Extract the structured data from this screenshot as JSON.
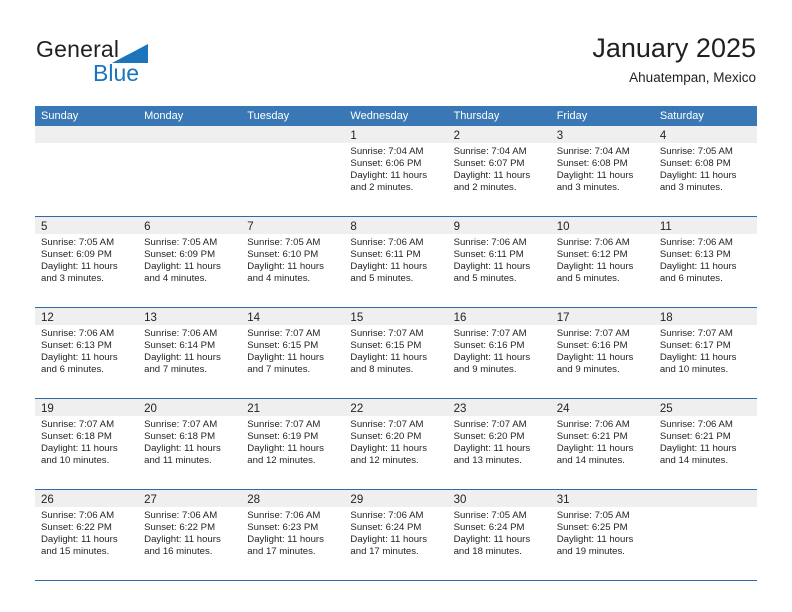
{
  "brand": {
    "name_part1": "General",
    "name_part2": "Blue",
    "accent_color": "#1c75bc"
  },
  "header": {
    "title": "January 2025",
    "subtitle": "Ahuatempan, Mexico"
  },
  "theme": {
    "header_band": "#3a78b5",
    "daynum_band": "#efefef",
    "week_divider": "#2f6aa8"
  },
  "weekdays": [
    "Sunday",
    "Monday",
    "Tuesday",
    "Wednesday",
    "Thursday",
    "Friday",
    "Saturday"
  ],
  "weeks": [
    [
      {
        "day": "",
        "sunrise": "",
        "sunset": "",
        "daylight1": "",
        "daylight2": "",
        "blank": true
      },
      {
        "day": "",
        "sunrise": "",
        "sunset": "",
        "daylight1": "",
        "daylight2": "",
        "blank": true
      },
      {
        "day": "",
        "sunrise": "",
        "sunset": "",
        "daylight1": "",
        "daylight2": "",
        "blank": true
      },
      {
        "day": "1",
        "sunrise": "Sunrise: 7:04 AM",
        "sunset": "Sunset: 6:06 PM",
        "daylight1": "Daylight: 11 hours",
        "daylight2": "and 2 minutes."
      },
      {
        "day": "2",
        "sunrise": "Sunrise: 7:04 AM",
        "sunset": "Sunset: 6:07 PM",
        "daylight1": "Daylight: 11 hours",
        "daylight2": "and 2 minutes."
      },
      {
        "day": "3",
        "sunrise": "Sunrise: 7:04 AM",
        "sunset": "Sunset: 6:08 PM",
        "daylight1": "Daylight: 11 hours",
        "daylight2": "and 3 minutes."
      },
      {
        "day": "4",
        "sunrise": "Sunrise: 7:05 AM",
        "sunset": "Sunset: 6:08 PM",
        "daylight1": "Daylight: 11 hours",
        "daylight2": "and 3 minutes."
      }
    ],
    [
      {
        "day": "5",
        "sunrise": "Sunrise: 7:05 AM",
        "sunset": "Sunset: 6:09 PM",
        "daylight1": "Daylight: 11 hours",
        "daylight2": "and 3 minutes."
      },
      {
        "day": "6",
        "sunrise": "Sunrise: 7:05 AM",
        "sunset": "Sunset: 6:09 PM",
        "daylight1": "Daylight: 11 hours",
        "daylight2": "and 4 minutes."
      },
      {
        "day": "7",
        "sunrise": "Sunrise: 7:05 AM",
        "sunset": "Sunset: 6:10 PM",
        "daylight1": "Daylight: 11 hours",
        "daylight2": "and 4 minutes."
      },
      {
        "day": "8",
        "sunrise": "Sunrise: 7:06 AM",
        "sunset": "Sunset: 6:11 PM",
        "daylight1": "Daylight: 11 hours",
        "daylight2": "and 5 minutes."
      },
      {
        "day": "9",
        "sunrise": "Sunrise: 7:06 AM",
        "sunset": "Sunset: 6:11 PM",
        "daylight1": "Daylight: 11 hours",
        "daylight2": "and 5 minutes."
      },
      {
        "day": "10",
        "sunrise": "Sunrise: 7:06 AM",
        "sunset": "Sunset: 6:12 PM",
        "daylight1": "Daylight: 11 hours",
        "daylight2": "and 5 minutes."
      },
      {
        "day": "11",
        "sunrise": "Sunrise: 7:06 AM",
        "sunset": "Sunset: 6:13 PM",
        "daylight1": "Daylight: 11 hours",
        "daylight2": "and 6 minutes."
      }
    ],
    [
      {
        "day": "12",
        "sunrise": "Sunrise: 7:06 AM",
        "sunset": "Sunset: 6:13 PM",
        "daylight1": "Daylight: 11 hours",
        "daylight2": "and 6 minutes."
      },
      {
        "day": "13",
        "sunrise": "Sunrise: 7:06 AM",
        "sunset": "Sunset: 6:14 PM",
        "daylight1": "Daylight: 11 hours",
        "daylight2": "and 7 minutes."
      },
      {
        "day": "14",
        "sunrise": "Sunrise: 7:07 AM",
        "sunset": "Sunset: 6:15 PM",
        "daylight1": "Daylight: 11 hours",
        "daylight2": "and 7 minutes."
      },
      {
        "day": "15",
        "sunrise": "Sunrise: 7:07 AM",
        "sunset": "Sunset: 6:15 PM",
        "daylight1": "Daylight: 11 hours",
        "daylight2": "and 8 minutes."
      },
      {
        "day": "16",
        "sunrise": "Sunrise: 7:07 AM",
        "sunset": "Sunset: 6:16 PM",
        "daylight1": "Daylight: 11 hours",
        "daylight2": "and 9 minutes."
      },
      {
        "day": "17",
        "sunrise": "Sunrise: 7:07 AM",
        "sunset": "Sunset: 6:16 PM",
        "daylight1": "Daylight: 11 hours",
        "daylight2": "and 9 minutes."
      },
      {
        "day": "18",
        "sunrise": "Sunrise: 7:07 AM",
        "sunset": "Sunset: 6:17 PM",
        "daylight1": "Daylight: 11 hours",
        "daylight2": "and 10 minutes."
      }
    ],
    [
      {
        "day": "19",
        "sunrise": "Sunrise: 7:07 AM",
        "sunset": "Sunset: 6:18 PM",
        "daylight1": "Daylight: 11 hours",
        "daylight2": "and 10 minutes."
      },
      {
        "day": "20",
        "sunrise": "Sunrise: 7:07 AM",
        "sunset": "Sunset: 6:18 PM",
        "daylight1": "Daylight: 11 hours",
        "daylight2": "and 11 minutes."
      },
      {
        "day": "21",
        "sunrise": "Sunrise: 7:07 AM",
        "sunset": "Sunset: 6:19 PM",
        "daylight1": "Daylight: 11 hours",
        "daylight2": "and 12 minutes."
      },
      {
        "day": "22",
        "sunrise": "Sunrise: 7:07 AM",
        "sunset": "Sunset: 6:20 PM",
        "daylight1": "Daylight: 11 hours",
        "daylight2": "and 12 minutes."
      },
      {
        "day": "23",
        "sunrise": "Sunrise: 7:07 AM",
        "sunset": "Sunset: 6:20 PM",
        "daylight1": "Daylight: 11 hours",
        "daylight2": "and 13 minutes."
      },
      {
        "day": "24",
        "sunrise": "Sunrise: 7:06 AM",
        "sunset": "Sunset: 6:21 PM",
        "daylight1": "Daylight: 11 hours",
        "daylight2": "and 14 minutes."
      },
      {
        "day": "25",
        "sunrise": "Sunrise: 7:06 AM",
        "sunset": "Sunset: 6:21 PM",
        "daylight1": "Daylight: 11 hours",
        "daylight2": "and 14 minutes."
      }
    ],
    [
      {
        "day": "26",
        "sunrise": "Sunrise: 7:06 AM",
        "sunset": "Sunset: 6:22 PM",
        "daylight1": "Daylight: 11 hours",
        "daylight2": "and 15 minutes."
      },
      {
        "day": "27",
        "sunrise": "Sunrise: 7:06 AM",
        "sunset": "Sunset: 6:22 PM",
        "daylight1": "Daylight: 11 hours",
        "daylight2": "and 16 minutes."
      },
      {
        "day": "28",
        "sunrise": "Sunrise: 7:06 AM",
        "sunset": "Sunset: 6:23 PM",
        "daylight1": "Daylight: 11 hours",
        "daylight2": "and 17 minutes."
      },
      {
        "day": "29",
        "sunrise": "Sunrise: 7:06 AM",
        "sunset": "Sunset: 6:24 PM",
        "daylight1": "Daylight: 11 hours",
        "daylight2": "and 17 minutes."
      },
      {
        "day": "30",
        "sunrise": "Sunrise: 7:05 AM",
        "sunset": "Sunset: 6:24 PM",
        "daylight1": "Daylight: 11 hours",
        "daylight2": "and 18 minutes."
      },
      {
        "day": "31",
        "sunrise": "Sunrise: 7:05 AM",
        "sunset": "Sunset: 6:25 PM",
        "daylight1": "Daylight: 11 hours",
        "daylight2": "and 19 minutes."
      },
      {
        "day": "",
        "sunrise": "",
        "sunset": "",
        "daylight1": "",
        "daylight2": "",
        "blank": true
      }
    ]
  ]
}
